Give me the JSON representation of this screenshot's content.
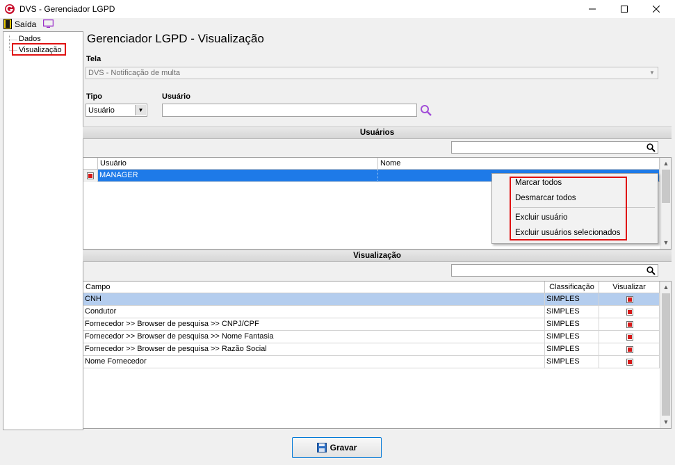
{
  "window": {
    "title": "DVS - Gerenciador LGPD"
  },
  "menu": {
    "exit_label": "Saída"
  },
  "tree": {
    "items": [
      "Dados",
      "Visualização"
    ]
  },
  "page": {
    "title": "Gerenciador LGPD - Visualização"
  },
  "tela": {
    "label": "Tela",
    "value": "DVS - Notificação de multa"
  },
  "tipo": {
    "label": "Tipo",
    "value": "Usuário"
  },
  "usuario": {
    "label": "Usuário",
    "value": ""
  },
  "users_section": {
    "title": "Usuários",
    "search_value": "",
    "columns": [
      "Usuário",
      "Nome"
    ],
    "rows": [
      {
        "checked": true,
        "usuario": "MANAGER",
        "nome": ""
      }
    ]
  },
  "context_menu": {
    "items": [
      "Marcar todos",
      "Desmarcar todos",
      "Excluir usuário",
      "Excluir usuários selecionados"
    ]
  },
  "visual_section": {
    "title": "Visualização",
    "search_value": "",
    "columns": [
      "Campo",
      "Classificação",
      "Visualizar"
    ],
    "rows": [
      {
        "campo": "CNH",
        "classificacao": "SIMPLES",
        "visualizar": true
      },
      {
        "campo": "Condutor",
        "classificacao": "SIMPLES",
        "visualizar": true
      },
      {
        "campo": "Fornecedor >> Browser de pesquisa >> CNPJ/CPF",
        "classificacao": "SIMPLES",
        "visualizar": true
      },
      {
        "campo": "Fornecedor >> Browser de pesquisa >> Nome Fantasia",
        "classificacao": "SIMPLES",
        "visualizar": true
      },
      {
        "campo": "Fornecedor >> Browser de pesquisa >> Razão Social",
        "classificacao": "SIMPLES",
        "visualizar": true
      },
      {
        "campo": "Nome Fornecedor",
        "classificacao": "SIMPLES",
        "visualizar": true
      }
    ]
  },
  "footer": {
    "save_label": "Gravar"
  },
  "colors": {
    "selection": "#1e7ae8",
    "row_highlight": "#b4cdee",
    "highlight_box": "#e01010",
    "accent": "#0078d7"
  }
}
